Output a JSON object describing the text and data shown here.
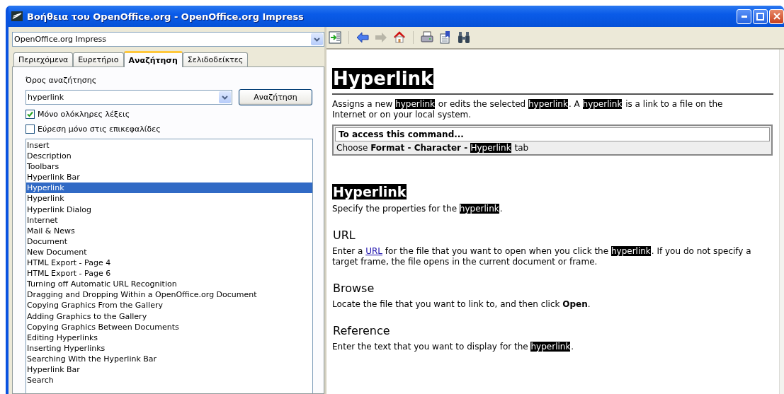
{
  "window": {
    "title": "Βοήθεια του OpenOffice.org - OpenOffice.org Impress"
  },
  "module_select": {
    "value": "OpenOffice.org Impress"
  },
  "tabs": [
    {
      "label": "Περιεχόμενα",
      "selected": false
    },
    {
      "label": "Ευρετήριο",
      "selected": false
    },
    {
      "label": "Αναζήτηση",
      "selected": true
    },
    {
      "label": "Σελιδοδείκτες",
      "selected": false
    }
  ],
  "search": {
    "label": "Όρος αναζήτησης",
    "value": "hyperlink",
    "button": "Αναζήτηση"
  },
  "options": [
    {
      "label": "Μόνο ολόκληρες λέξεις",
      "checked": true
    },
    {
      "label": "Εύρεση μόνο στις επικεφαλίδες",
      "checked": false
    }
  ],
  "results": [
    {
      "label": "Insert",
      "selected": false
    },
    {
      "label": "Description",
      "selected": false
    },
    {
      "label": "Toolbars",
      "selected": false
    },
    {
      "label": "Hyperlink Bar",
      "selected": false
    },
    {
      "label": "Hyperlink",
      "selected": true
    },
    {
      "label": "Hyperlink",
      "selected": false
    },
    {
      "label": "Hyperlink Dialog",
      "selected": false
    },
    {
      "label": "Internet",
      "selected": false
    },
    {
      "label": "Mail & News",
      "selected": false
    },
    {
      "label": "Document",
      "selected": false
    },
    {
      "label": "New Document",
      "selected": false
    },
    {
      "label": "HTML Export - Page 4",
      "selected": false
    },
    {
      "label": "HTML Export - Page 6",
      "selected": false
    },
    {
      "label": "Turning off Automatic URL Recognition",
      "selected": false
    },
    {
      "label": "Dragging and Dropping Within a OpenOffice.org Document",
      "selected": false
    },
    {
      "label": "Copying Graphics From the Gallery",
      "selected": false
    },
    {
      "label": "Adding Graphics to the Gallery",
      "selected": false
    },
    {
      "label": "Copying Graphics Between Documents",
      "selected": false
    },
    {
      "label": "Editing Hyperlinks",
      "selected": false
    },
    {
      "label": "Inserting Hyperlinks",
      "selected": false
    },
    {
      "label": "Searching With the Hyperlink Bar",
      "selected": false
    },
    {
      "label": "Hyperlink Bar",
      "selected": false
    },
    {
      "label": "Search",
      "selected": false
    }
  ],
  "toolbar": [
    {
      "kind": "index"
    },
    {
      "kind": "separator"
    },
    {
      "kind": "back"
    },
    {
      "kind": "forward"
    },
    {
      "kind": "home"
    },
    {
      "kind": "separator"
    },
    {
      "kind": "print"
    },
    {
      "kind": "bookmark"
    },
    {
      "kind": "find"
    }
  ],
  "document": [
    {
      "kind": "title",
      "text": "Hyperlink",
      "highlighted": true
    },
    {
      "kind": "paragraph",
      "segments": [
        {
          "kind": "plain",
          "text": "Assigns a new "
        },
        {
          "kind": "mark",
          "text": "hyperlink"
        },
        {
          "kind": "plain",
          "text": " or edits the selected "
        },
        {
          "kind": "mark",
          "text": "hyperlink"
        },
        {
          "kind": "plain",
          "text": ". A "
        },
        {
          "kind": "mark",
          "text": "hyperlink"
        },
        {
          "kind": "plain",
          "text": " is a link to a file on the Internet or on your local system."
        }
      ]
    },
    {
      "kind": "access_box",
      "heading": "To access this command...",
      "segments": [
        {
          "kind": "plain",
          "text": "Choose "
        },
        {
          "kind": "bold",
          "text": "Format - Character - "
        },
        {
          "kind": "mark",
          "text": "Hyperlink"
        },
        {
          "kind": "plain",
          "text": " tab"
        }
      ]
    },
    {
      "kind": "heading",
      "text": "Hyperlink",
      "highlighted": true
    },
    {
      "kind": "paragraph",
      "segments": [
        {
          "kind": "plain",
          "text": "Specify the properties for the "
        },
        {
          "kind": "mark",
          "text": "hyperlink"
        },
        {
          "kind": "plain",
          "text": "."
        }
      ]
    },
    {
      "kind": "subheading",
      "text": "URL",
      "highlighted": false
    },
    {
      "kind": "paragraph",
      "segments": [
        {
          "kind": "plain",
          "text": "Enter a "
        },
        {
          "kind": "link",
          "text": "URL"
        },
        {
          "kind": "plain",
          "text": " for the file that you want to open when you click the "
        },
        {
          "kind": "mark",
          "text": "hyperlink"
        },
        {
          "kind": "plain",
          "text": ". If you do not specify a target frame, the file opens in the current document or frame."
        }
      ]
    },
    {
      "kind": "subheading",
      "text": "Browse",
      "highlighted": false
    },
    {
      "kind": "paragraph",
      "segments": [
        {
          "kind": "plain",
          "text": "Locate the file that you want to link to, and then click "
        },
        {
          "kind": "bold",
          "text": "Open"
        },
        {
          "kind": "plain",
          "text": "."
        }
      ]
    },
    {
      "kind": "subheading",
      "text": "Reference",
      "highlighted": false
    },
    {
      "kind": "paragraph",
      "segments": [
        {
          "kind": "plain",
          "text": "Enter the text that you want to display for the "
        },
        {
          "kind": "mark",
          "text": "hyperlink"
        },
        {
          "kind": "plain",
          "text": "."
        }
      ]
    }
  ]
}
